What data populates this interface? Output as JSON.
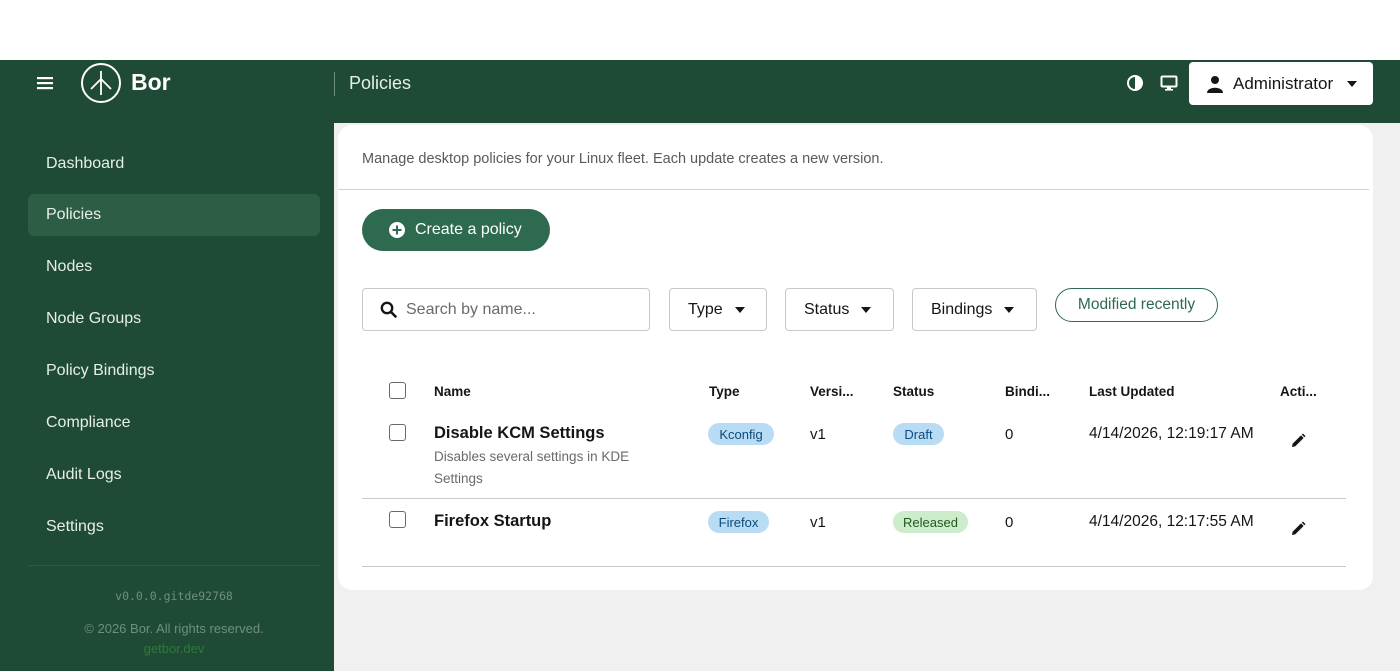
{
  "app": {
    "name": "Bor"
  },
  "header": {
    "page_title": "Policies",
    "user_label": "Administrator"
  },
  "sidebar": {
    "items": [
      {
        "label": "Dashboard",
        "active": false
      },
      {
        "label": "Policies",
        "active": true
      },
      {
        "label": "Nodes",
        "active": false
      },
      {
        "label": "Node Groups",
        "active": false
      },
      {
        "label": "Policy Bindings",
        "active": false
      },
      {
        "label": "Compliance",
        "active": false
      },
      {
        "label": "Audit Logs",
        "active": false
      },
      {
        "label": "Settings",
        "active": false
      }
    ],
    "version": "v0.0.0.gitde92768",
    "copyright": "© 2026 Bor. All rights reserved.",
    "link": "getbor.dev"
  },
  "main": {
    "description": "Manage desktop policies for your Linux fleet. Each update creates a new version.",
    "create_label": "Create a policy",
    "search_placeholder": "Search by name...",
    "filters": [
      "Type",
      "Status",
      "Bindings"
    ],
    "sort_chip": "Modified recently",
    "columns": [
      "Name",
      "Type",
      "Versi...",
      "Status",
      "Bindi...",
      "Last Updated",
      "Acti..."
    ],
    "rows": [
      {
        "name": "Disable KCM Settings",
        "description": "Disables several settings in KDE Settings",
        "type": "Kconfig",
        "version": "v1",
        "status": "Draft",
        "bindings": "0",
        "updated": "4/14/2026, 12:19:17 AM"
      },
      {
        "name": "Firefox Startup",
        "description": "",
        "type": "Firefox",
        "version": "v1",
        "status": "Released",
        "bindings": "0",
        "updated": "4/14/2026, 12:17:55 AM"
      }
    ]
  },
  "colors": {
    "brand_dark": "#1f4a35",
    "nav_active": "#2d5e45",
    "primary": "#2d6a4f",
    "badge_blue": "#b9dcf5",
    "badge_green": "#cdeccb"
  }
}
